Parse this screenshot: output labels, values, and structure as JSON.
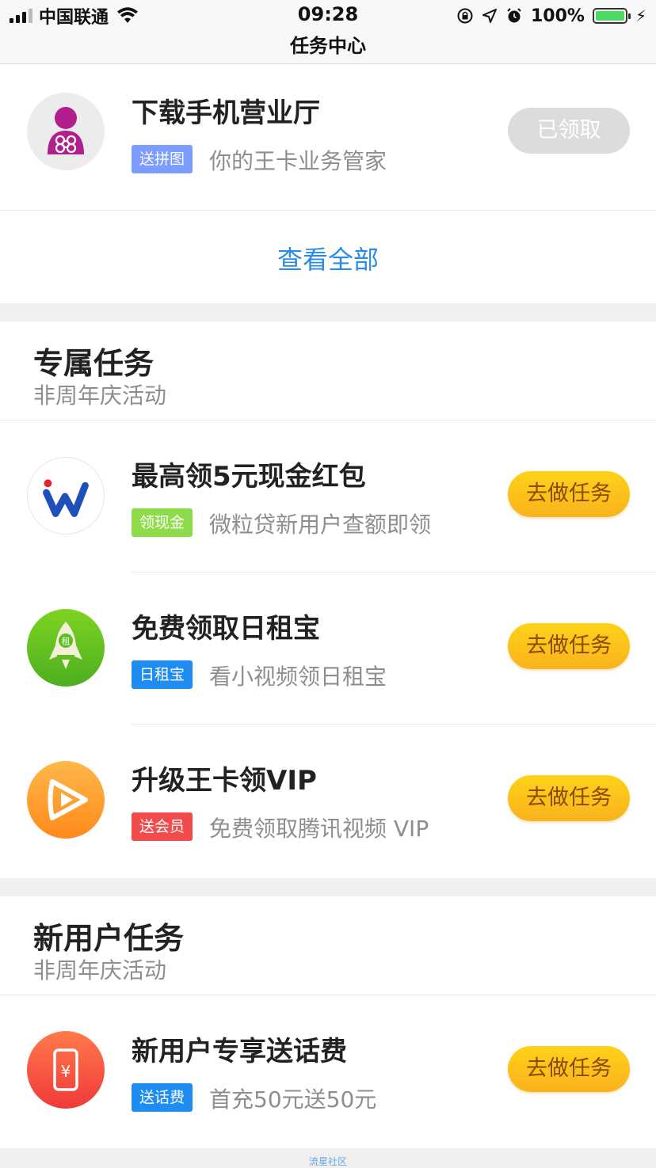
{
  "status_bar": {
    "carrier": "中国联通",
    "time": "09:28",
    "battery": "100%",
    "title": "任务中心",
    "colors": {
      "battery": "#4cd964"
    }
  },
  "top_task": {
    "title": "下载手机营业厅",
    "tag": "送拼图",
    "desc": "你的王卡业务管家",
    "button": "已领取",
    "icon": "china-unicom-person-icon",
    "tag_color": "#7c9cff"
  },
  "view_all": "查看全部",
  "exclusive": {
    "title": "专属任务",
    "subtitle": "非周年庆活动",
    "items": [
      {
        "title": "最高领5元现金红包",
        "tag": "领现金",
        "desc": "微粒贷新用户查额即领",
        "button": "去做任务",
        "icon": "weilidai-w-icon",
        "tag_color": "#8fdc4a"
      },
      {
        "title": "免费领取日租宝",
        "tag": "日租宝",
        "desc": "看小视频领日租宝",
        "button": "去做任务",
        "icon": "rocket-icon",
        "tag_color": "#1e8cf0"
      },
      {
        "title": "升级王卡领VIP",
        "tag": "送会员",
        "desc": "免费领取腾讯视频 VIP",
        "button": "去做任务",
        "icon": "tencent-video-play-icon",
        "tag_color": "#f24b4b"
      }
    ]
  },
  "new_user": {
    "title": "新用户任务",
    "subtitle": "非周年庆活动",
    "items": [
      {
        "title": "新用户专享送话费",
        "tag": "送话费",
        "desc": "首充50元送50元",
        "button": "去做任务",
        "icon": "phone-yen-icon",
        "tag_color": "#1e8cf0"
      }
    ]
  },
  "watermark": "流星社区"
}
